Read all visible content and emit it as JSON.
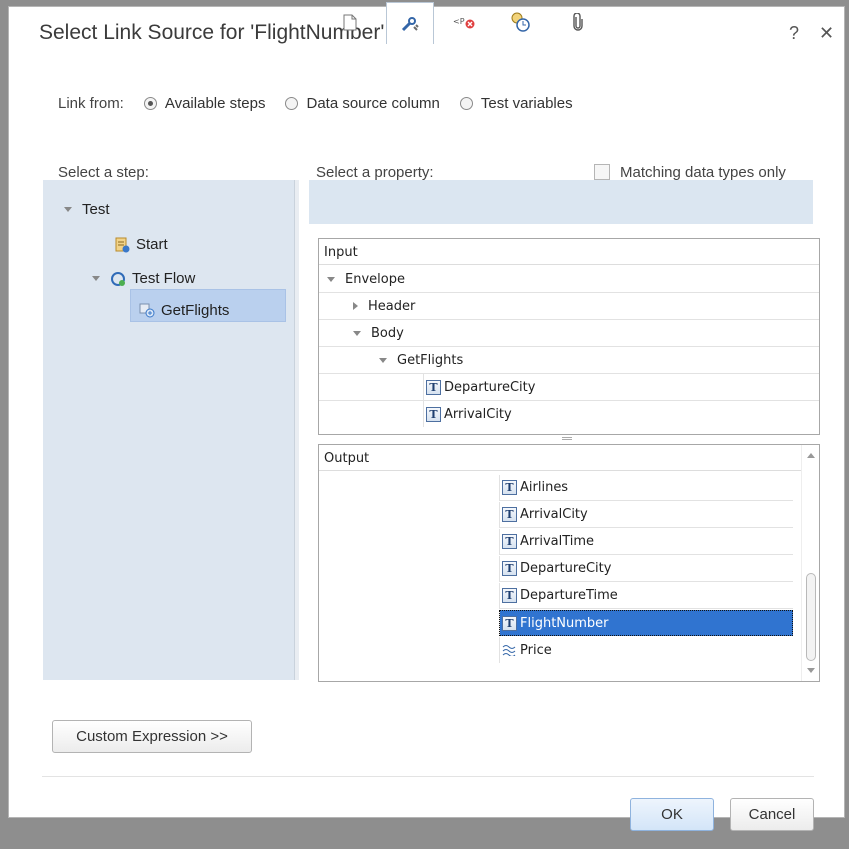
{
  "dialog": {
    "title": "Select Link Source for 'FlightNumber'",
    "help_label": "?",
    "close_label": "✕"
  },
  "link_from": {
    "label": "Link from:",
    "options": [
      {
        "label": "Available steps",
        "selected": true
      },
      {
        "label": "Data source column",
        "selected": false
      },
      {
        "label": "Test variables",
        "selected": false
      }
    ]
  },
  "steps": {
    "label": "Select a step:",
    "tree": [
      {
        "label": "Test",
        "expanded": true,
        "level": 0
      },
      {
        "label": "Start",
        "icon": "start-icon",
        "level": 1
      },
      {
        "label": "Test Flow",
        "expanded": true,
        "icon": "flow-icon",
        "level": 1
      },
      {
        "label": "GetFlights",
        "icon": "service-icon",
        "level": 2,
        "selected": true
      }
    ]
  },
  "property": {
    "label": "Select a property:",
    "matching_label": "Matching data types only",
    "matching_checked": false,
    "tabs": [
      "document-icon",
      "wrench-icon",
      "xml-error-icon",
      "clock-icon",
      "attachment-icon"
    ],
    "active_tab": 1
  },
  "input_grid": {
    "header": "Input",
    "rows": [
      {
        "label": "Envelope",
        "expanded": true
      },
      {
        "label": "Header",
        "expanded": false
      },
      {
        "label": "Body",
        "expanded": true
      },
      {
        "label": "GetFlights",
        "expanded": true
      },
      {
        "label": "DepartureCity",
        "icon": "text-type-icon"
      },
      {
        "label": "ArrivalCity",
        "icon": "text-type-icon"
      }
    ]
  },
  "output_grid": {
    "header": "Output",
    "rows": [
      {
        "label": "Airlines",
        "icon": "text-type-icon"
      },
      {
        "label": "ArrivalCity",
        "icon": "text-type-icon"
      },
      {
        "label": "ArrivalTime",
        "icon": "text-type-icon"
      },
      {
        "label": "DepartureCity",
        "icon": "text-type-icon"
      },
      {
        "label": "DepartureTime",
        "icon": "text-type-icon"
      },
      {
        "label": "FlightNumber",
        "icon": "text-type-icon",
        "selected": true
      },
      {
        "label": "Price",
        "icon": "numeric-type-icon"
      }
    ]
  },
  "buttons": {
    "custom_expression": "Custom Expression >>",
    "ok": "OK",
    "cancel": "Cancel"
  },
  "colors": {
    "selection": "#3074d0",
    "step_selection": "#bad0ee",
    "pane_background": "#dde6f0"
  }
}
